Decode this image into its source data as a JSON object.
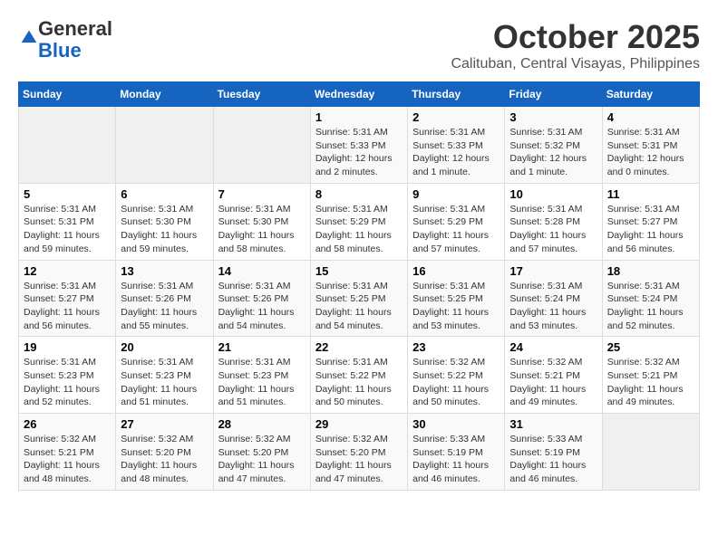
{
  "header": {
    "logo": {
      "general": "General",
      "blue": "Blue"
    },
    "month": "October 2025",
    "location": "Calituban, Central Visayas, Philippines"
  },
  "days_of_week": [
    "Sunday",
    "Monday",
    "Tuesday",
    "Wednesday",
    "Thursday",
    "Friday",
    "Saturday"
  ],
  "weeks": [
    [
      {
        "day": "",
        "info": ""
      },
      {
        "day": "",
        "info": ""
      },
      {
        "day": "",
        "info": ""
      },
      {
        "day": "1",
        "info": "Sunrise: 5:31 AM\nSunset: 5:33 PM\nDaylight: 12 hours\nand 2 minutes."
      },
      {
        "day": "2",
        "info": "Sunrise: 5:31 AM\nSunset: 5:33 PM\nDaylight: 12 hours\nand 1 minute."
      },
      {
        "day": "3",
        "info": "Sunrise: 5:31 AM\nSunset: 5:32 PM\nDaylight: 12 hours\nand 1 minute."
      },
      {
        "day": "4",
        "info": "Sunrise: 5:31 AM\nSunset: 5:31 PM\nDaylight: 12 hours\nand 0 minutes."
      }
    ],
    [
      {
        "day": "5",
        "info": "Sunrise: 5:31 AM\nSunset: 5:31 PM\nDaylight: 11 hours\nand 59 minutes."
      },
      {
        "day": "6",
        "info": "Sunrise: 5:31 AM\nSunset: 5:30 PM\nDaylight: 11 hours\nand 59 minutes."
      },
      {
        "day": "7",
        "info": "Sunrise: 5:31 AM\nSunset: 5:30 PM\nDaylight: 11 hours\nand 58 minutes."
      },
      {
        "day": "8",
        "info": "Sunrise: 5:31 AM\nSunset: 5:29 PM\nDaylight: 11 hours\nand 58 minutes."
      },
      {
        "day": "9",
        "info": "Sunrise: 5:31 AM\nSunset: 5:29 PM\nDaylight: 11 hours\nand 57 minutes."
      },
      {
        "day": "10",
        "info": "Sunrise: 5:31 AM\nSunset: 5:28 PM\nDaylight: 11 hours\nand 57 minutes."
      },
      {
        "day": "11",
        "info": "Sunrise: 5:31 AM\nSunset: 5:27 PM\nDaylight: 11 hours\nand 56 minutes."
      }
    ],
    [
      {
        "day": "12",
        "info": "Sunrise: 5:31 AM\nSunset: 5:27 PM\nDaylight: 11 hours\nand 56 minutes."
      },
      {
        "day": "13",
        "info": "Sunrise: 5:31 AM\nSunset: 5:26 PM\nDaylight: 11 hours\nand 55 minutes."
      },
      {
        "day": "14",
        "info": "Sunrise: 5:31 AM\nSunset: 5:26 PM\nDaylight: 11 hours\nand 54 minutes."
      },
      {
        "day": "15",
        "info": "Sunrise: 5:31 AM\nSunset: 5:25 PM\nDaylight: 11 hours\nand 54 minutes."
      },
      {
        "day": "16",
        "info": "Sunrise: 5:31 AM\nSunset: 5:25 PM\nDaylight: 11 hours\nand 53 minutes."
      },
      {
        "day": "17",
        "info": "Sunrise: 5:31 AM\nSunset: 5:24 PM\nDaylight: 11 hours\nand 53 minutes."
      },
      {
        "day": "18",
        "info": "Sunrise: 5:31 AM\nSunset: 5:24 PM\nDaylight: 11 hours\nand 52 minutes."
      }
    ],
    [
      {
        "day": "19",
        "info": "Sunrise: 5:31 AM\nSunset: 5:23 PM\nDaylight: 11 hours\nand 52 minutes."
      },
      {
        "day": "20",
        "info": "Sunrise: 5:31 AM\nSunset: 5:23 PM\nDaylight: 11 hours\nand 51 minutes."
      },
      {
        "day": "21",
        "info": "Sunrise: 5:31 AM\nSunset: 5:23 PM\nDaylight: 11 hours\nand 51 minutes."
      },
      {
        "day": "22",
        "info": "Sunrise: 5:31 AM\nSunset: 5:22 PM\nDaylight: 11 hours\nand 50 minutes."
      },
      {
        "day": "23",
        "info": "Sunrise: 5:32 AM\nSunset: 5:22 PM\nDaylight: 11 hours\nand 50 minutes."
      },
      {
        "day": "24",
        "info": "Sunrise: 5:32 AM\nSunset: 5:21 PM\nDaylight: 11 hours\nand 49 minutes."
      },
      {
        "day": "25",
        "info": "Sunrise: 5:32 AM\nSunset: 5:21 PM\nDaylight: 11 hours\nand 49 minutes."
      }
    ],
    [
      {
        "day": "26",
        "info": "Sunrise: 5:32 AM\nSunset: 5:21 PM\nDaylight: 11 hours\nand 48 minutes."
      },
      {
        "day": "27",
        "info": "Sunrise: 5:32 AM\nSunset: 5:20 PM\nDaylight: 11 hours\nand 48 minutes."
      },
      {
        "day": "28",
        "info": "Sunrise: 5:32 AM\nSunset: 5:20 PM\nDaylight: 11 hours\nand 47 minutes."
      },
      {
        "day": "29",
        "info": "Sunrise: 5:32 AM\nSunset: 5:20 PM\nDaylight: 11 hours\nand 47 minutes."
      },
      {
        "day": "30",
        "info": "Sunrise: 5:33 AM\nSunset: 5:19 PM\nDaylight: 11 hours\nand 46 minutes."
      },
      {
        "day": "31",
        "info": "Sunrise: 5:33 AM\nSunset: 5:19 PM\nDaylight: 11 hours\nand 46 minutes."
      },
      {
        "day": "",
        "info": ""
      }
    ]
  ]
}
